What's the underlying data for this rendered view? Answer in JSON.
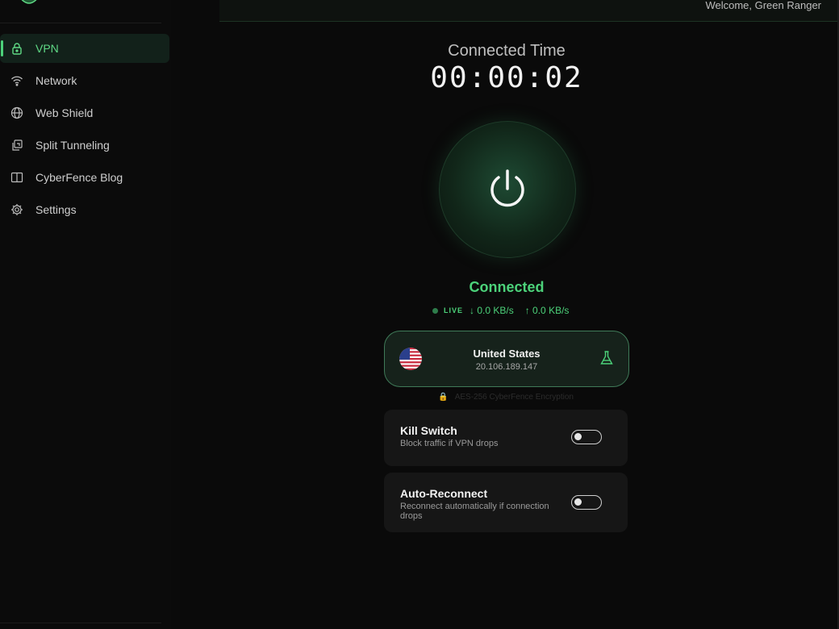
{
  "header": {
    "welcome": "Welcome, Green Ranger"
  },
  "sidebar": {
    "items": [
      {
        "label": "VPN",
        "icon": "lock-icon",
        "active": true
      },
      {
        "label": "Network",
        "icon": "wifi-icon",
        "active": false
      },
      {
        "label": "Web Shield",
        "icon": "globe-icon",
        "active": false
      },
      {
        "label": "Split Tunneling",
        "icon": "split-tunnel-icon",
        "active": false
      },
      {
        "label": "CyberFence Blog",
        "icon": "book-icon",
        "active": false
      },
      {
        "label": "Settings",
        "icon": "gear-icon",
        "active": false
      }
    ]
  },
  "main": {
    "connected_time_label": "Connected Time",
    "connected_time": "00:00:02",
    "status": "Connected",
    "live_label": "LIVE",
    "download": "↓ 0.0 KB/s",
    "upload": "↑ 0.0 KB/s",
    "server": {
      "country": "United States",
      "ip": "20.106.189.147",
      "flag": "us-flag-icon"
    },
    "encryption": "AES-256 CyberFence Encryption",
    "kill_switch": {
      "title": "Kill Switch",
      "subtitle": "Block traffic if VPN drops",
      "enabled": false
    },
    "auto_reconnect": {
      "title": "Auto-Reconnect",
      "subtitle": "Reconnect automatically if connection drops",
      "enabled": false
    }
  },
  "colors": {
    "accent": "#4cd27a",
    "background": "#0a0a0a",
    "card": "#161616",
    "lock": "#d08a3b"
  }
}
